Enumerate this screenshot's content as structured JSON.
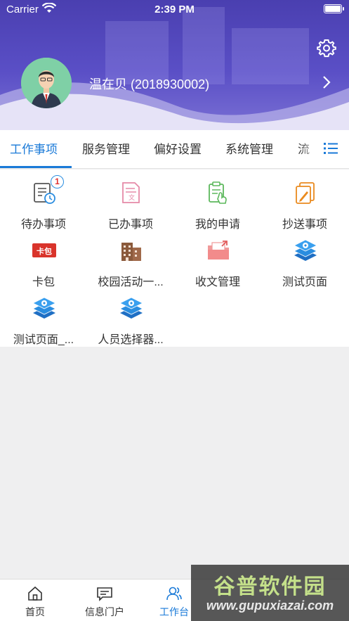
{
  "status_bar": {
    "carrier": "Carrier",
    "time": "2:39 PM"
  },
  "profile": {
    "name": "温在贝 (2018930002)"
  },
  "tabs": [
    {
      "label": "工作事项",
      "active": true
    },
    {
      "label": "服务管理",
      "active": false
    },
    {
      "label": "偏好设置",
      "active": false
    },
    {
      "label": "系统管理",
      "active": false
    },
    {
      "label": "流",
      "active": false
    }
  ],
  "grid": [
    {
      "label": "待办事项",
      "icon": "todo-icon",
      "badge": "1"
    },
    {
      "label": "已办事项",
      "icon": "done-doc-icon"
    },
    {
      "label": "我的申请",
      "icon": "application-icon"
    },
    {
      "label": "抄送事项",
      "icon": "cc-icon"
    },
    {
      "label": "卡包",
      "icon": "card-wallet-icon",
      "icon_text": "卡包"
    },
    {
      "label": "校园活动一...",
      "icon": "building-icon"
    },
    {
      "label": "收文管理",
      "icon": "folder-icon"
    },
    {
      "label": "测试页面",
      "icon": "layers-icon"
    },
    {
      "label": "测试页面_...",
      "icon": "layers-icon"
    },
    {
      "label": "人员选择器...",
      "icon": "layers-icon"
    }
  ],
  "bottom_tabs": [
    {
      "label": "首页",
      "icon": "home-icon",
      "active": false
    },
    {
      "label": "信息门户",
      "icon": "message-icon",
      "active": false
    },
    {
      "label": "工作台",
      "icon": "people-icon",
      "active": true
    }
  ],
  "watermark": {
    "title": "谷普软件园",
    "url": "www.gupuxiazai.com"
  },
  "colors": {
    "accent": "#1a7ad8",
    "header": "#4a3fb0",
    "badge_text": "#e03131"
  }
}
